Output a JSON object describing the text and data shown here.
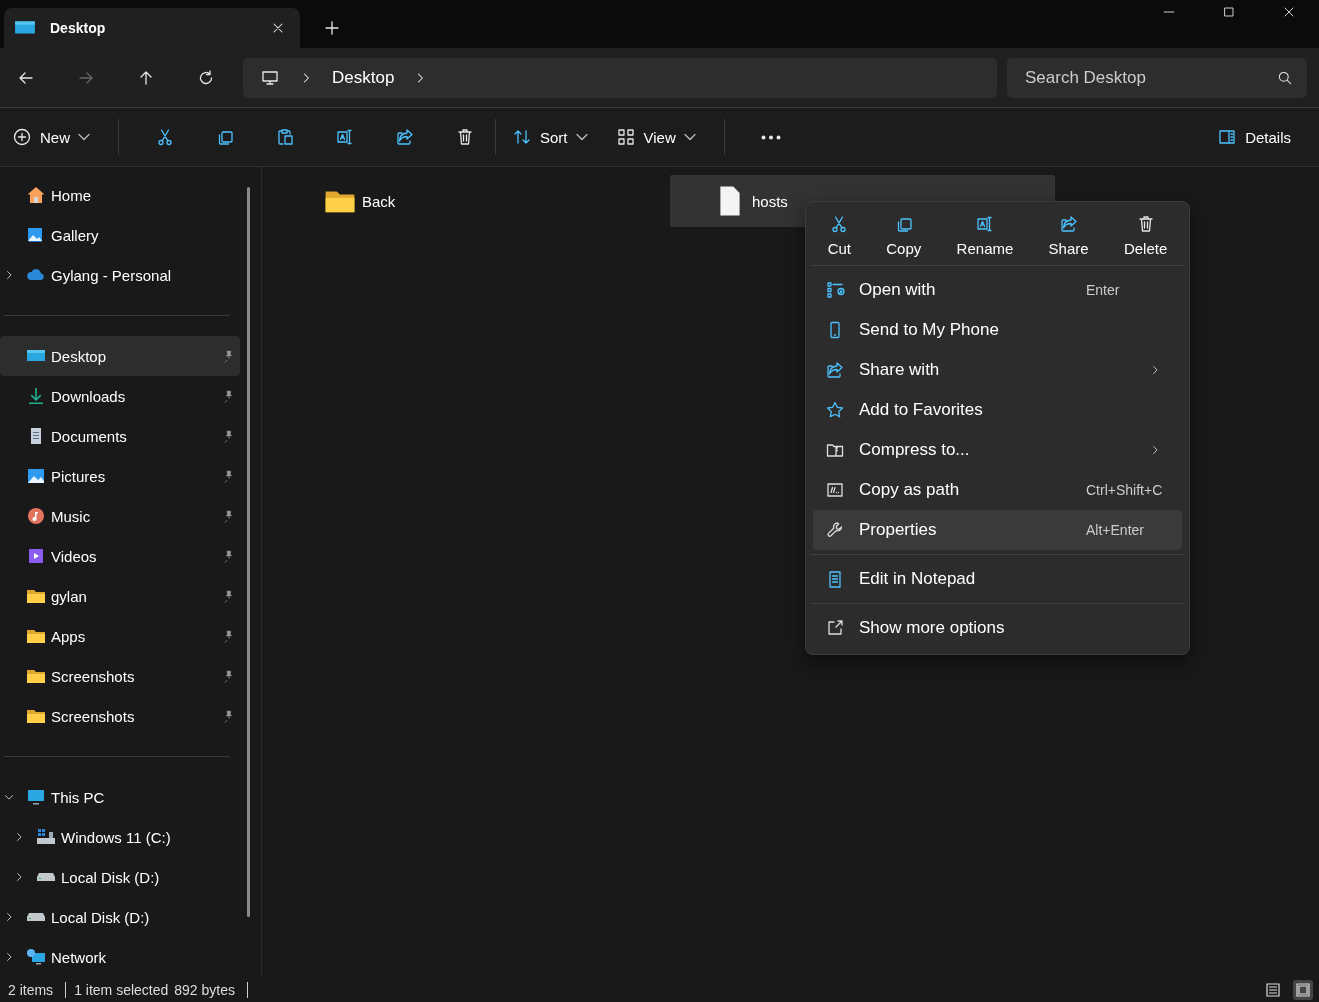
{
  "tabs": [
    {
      "label": "Desktop",
      "selected": true
    }
  ],
  "nav": {
    "buttons": [
      {
        "kind": "back",
        "disabled": false
      },
      {
        "kind": "forward",
        "disabled": true
      },
      {
        "kind": "up",
        "disabled": false
      },
      {
        "kind": "refresh",
        "disabled": false
      }
    ],
    "breadcrumb": [
      "Desktop"
    ],
    "search": {
      "placeholder": "Search Desktop"
    }
  },
  "toolbar": {
    "items": [
      {
        "kind": "new",
        "label": "New",
        "dropdown": true
      },
      {
        "kind": "separator"
      },
      {
        "kind": "cut"
      },
      {
        "kind": "copy"
      },
      {
        "kind": "paste"
      },
      {
        "kind": "rename"
      },
      {
        "kind": "share"
      },
      {
        "kind": "delete"
      },
      {
        "kind": "separator"
      },
      {
        "kind": "sort",
        "label": "Sort",
        "dropdown": true
      },
      {
        "kind": "view",
        "label": "View",
        "dropdown": true
      },
      {
        "kind": "separator"
      },
      {
        "kind": "more"
      }
    ],
    "details": {
      "label": "Details"
    }
  },
  "sidebar": {
    "sections": [
      {
        "items": [
          {
            "label": "Home",
            "kind": "home",
            "selected": false
          },
          {
            "label": "Gallery",
            "kind": "gallery",
            "selected": false
          },
          {
            "label": "Gylang - Personal",
            "kind": "cloud",
            "selected": false,
            "expanded": false
          }
        ]
      },
      {
        "items": [
          {
            "label": "Desktop",
            "kind": "desktop",
            "selected": true,
            "pinned": true
          },
          {
            "label": "Downloads",
            "kind": "download",
            "selected": false,
            "pinned": true
          },
          {
            "label": "Documents",
            "kind": "document",
            "selected": false,
            "pinned": true
          },
          {
            "label": "Pictures",
            "kind": "picture",
            "selected": false,
            "pinned": true
          },
          {
            "label": "Music",
            "kind": "music",
            "selected": false,
            "pinned": true
          },
          {
            "label": "Videos",
            "kind": "video",
            "selected": false,
            "pinned": true
          },
          {
            "label": "gylan",
            "kind": "folder",
            "selected": false,
            "pinned": true
          },
          {
            "label": "Apps",
            "kind": "folder",
            "selected": false,
            "pinned": true
          },
          {
            "label": "Screenshots",
            "kind": "folder",
            "selected": false,
            "pinned": true
          },
          {
            "label": "Screenshots",
            "kind": "folder",
            "selected": false,
            "pinned": true
          }
        ]
      },
      {
        "items": [
          {
            "label": "This PC",
            "kind": "pc",
            "selected": false,
            "expanded": true,
            "children": [
              {
                "label": "Windows 11 (C:)",
                "kind": "drive-c",
                "selected": false,
                "expanded": false
              },
              {
                "label": "Local Disk (D:)",
                "kind": "drive",
                "selected": false,
                "expanded": false
              }
            ]
          },
          {
            "label": "Local Disk (D:)",
            "kind": "drive",
            "selected": false,
            "expanded": false
          },
          {
            "label": "Network",
            "kind": "network",
            "selected": false,
            "expanded": false
          }
        ]
      }
    ]
  },
  "files": [
    {
      "name": "Back",
      "kind": "folder",
      "selected": false
    },
    {
      "name": "hosts",
      "kind": "file",
      "selected": true
    }
  ],
  "context_menu": {
    "actions": [
      {
        "kind": "cut",
        "label": "Cut"
      },
      {
        "kind": "copy",
        "label": "Copy"
      },
      {
        "kind": "rename",
        "label": "Rename"
      },
      {
        "kind": "share",
        "label": "Share"
      },
      {
        "kind": "delete",
        "label": "Delete"
      }
    ],
    "groups": [
      [
        {
          "kind": "open-with",
          "label": "Open with",
          "shortcut": "Enter",
          "submenu": false,
          "selected": false
        },
        {
          "kind": "phone",
          "label": "Send to My Phone",
          "submenu": false,
          "selected": false
        },
        {
          "kind": "share",
          "label": "Share with",
          "submenu": true,
          "selected": false
        },
        {
          "kind": "star",
          "label": "Add to Favorites",
          "submenu": false,
          "selected": false
        },
        {
          "kind": "compress",
          "label": "Compress to...",
          "submenu": true,
          "selected": false
        },
        {
          "kind": "path",
          "label": "Copy as path",
          "shortcut": "Ctrl+Shift+C",
          "submenu": false,
          "selected": false
        },
        {
          "kind": "wrench",
          "label": "Properties",
          "shortcut": "Alt+Enter",
          "submenu": false,
          "selected": true
        }
      ],
      [
        {
          "kind": "notepad",
          "label": "Edit in Notepad",
          "submenu": false,
          "selected": false
        }
      ],
      [
        {
          "kind": "show-more",
          "label": "Show more options",
          "submenu": false,
          "selected": false
        }
      ]
    ]
  },
  "status_bar": {
    "parts": [
      "2 items",
      "1 item selected",
      "892 bytes"
    ],
    "view_toggles": [
      {
        "kind": "list",
        "selected": false
      },
      {
        "kind": "tiles",
        "selected": true
      }
    ]
  }
}
